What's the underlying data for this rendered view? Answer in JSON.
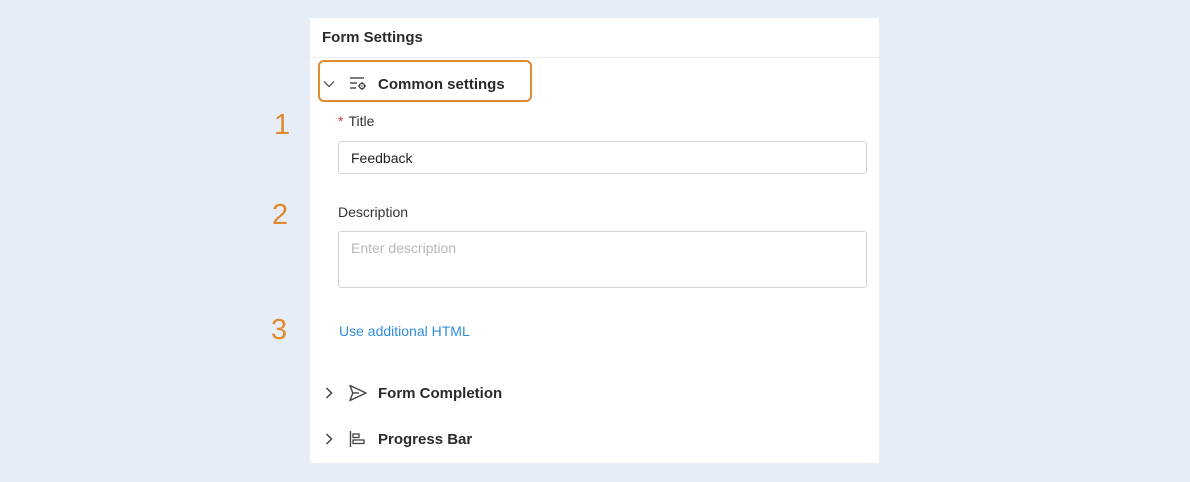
{
  "panel": {
    "title": "Form Settings"
  },
  "callouts": [
    "1",
    "2",
    "3"
  ],
  "sections": {
    "common": {
      "label": "Common settings",
      "icon": "settings-list-icon",
      "expanded": true
    },
    "completion": {
      "label": "Form Completion",
      "icon": "send-icon",
      "expanded": false
    },
    "progress": {
      "label": "Progress Bar",
      "icon": "progress-bar-icon",
      "expanded": false
    }
  },
  "fields": {
    "title": {
      "label": "Title",
      "required_mark": "*",
      "value": "Feedback"
    },
    "description": {
      "label": "Description",
      "placeholder": "Enter description",
      "value": ""
    }
  },
  "links": {
    "additional_html": "Use additional HTML"
  },
  "colors": {
    "accent_orange": "#e08a2e",
    "link_blue": "#2f8ee0",
    "required_red": "#d9363e"
  }
}
